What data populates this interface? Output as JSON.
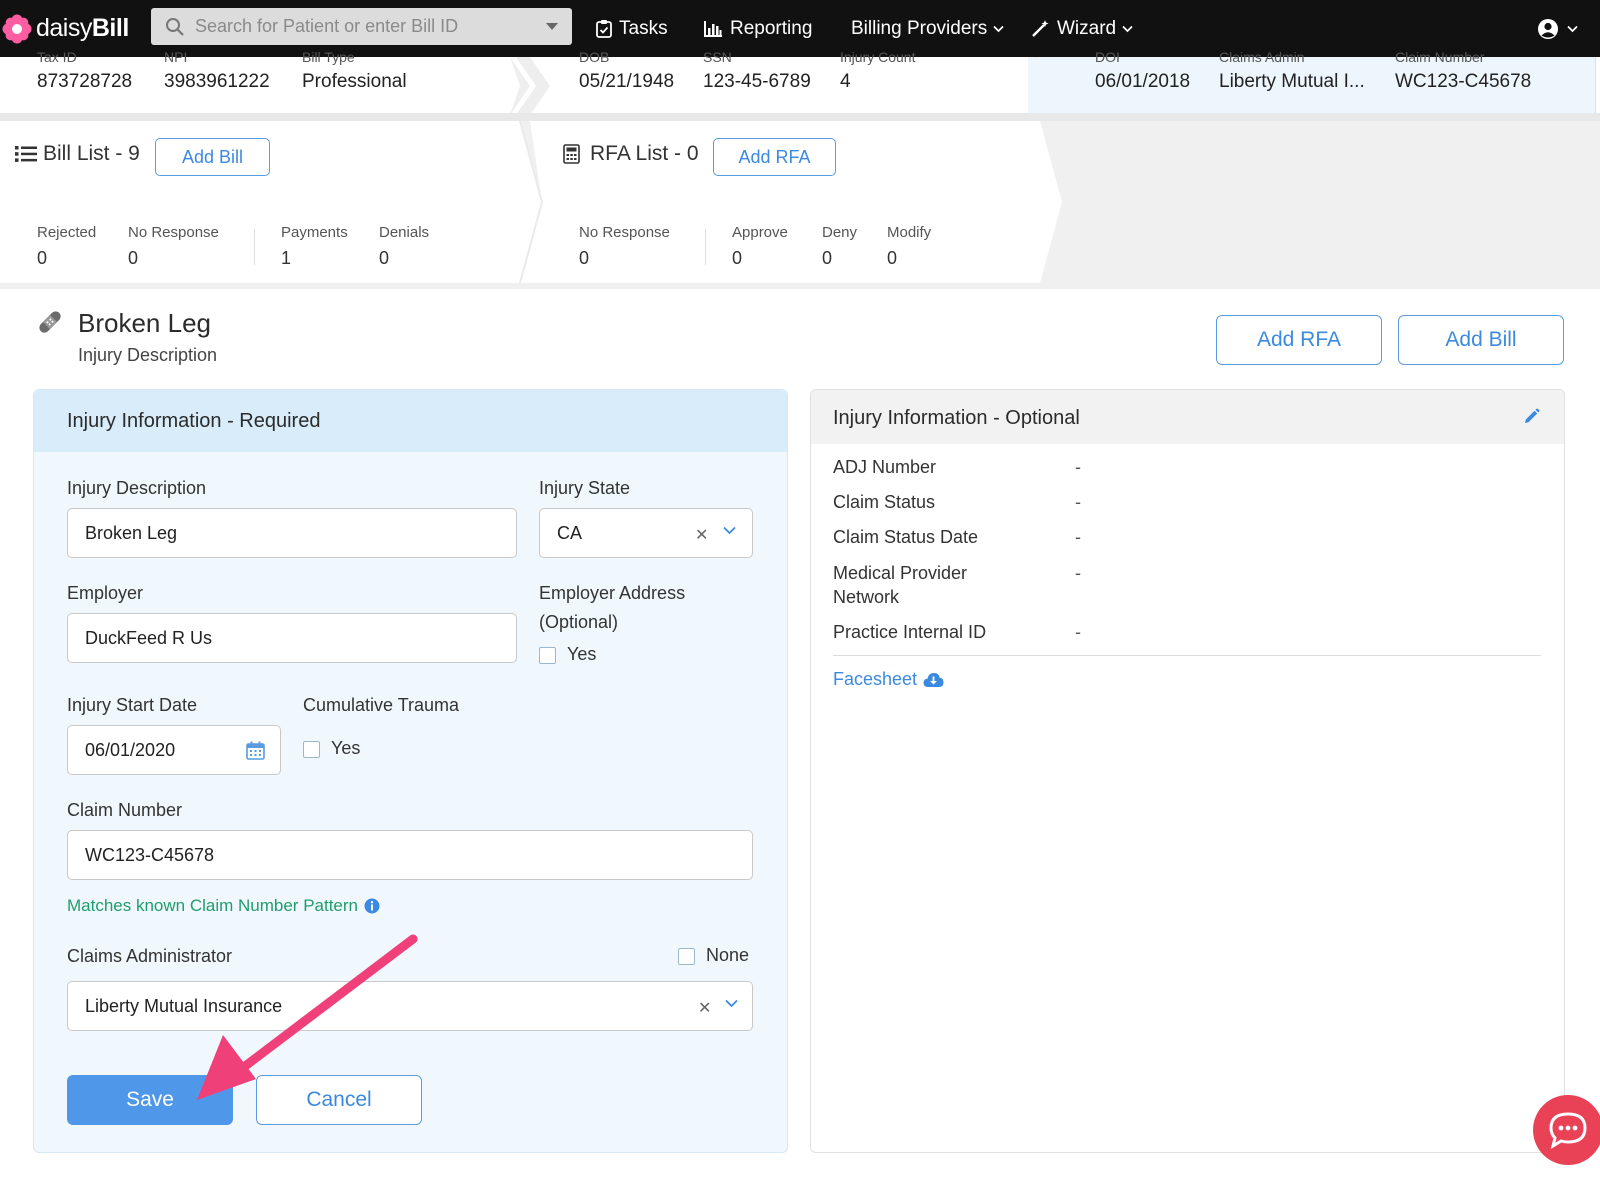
{
  "app": {
    "brand_light": "daisy",
    "brand_bold": "Bill"
  },
  "nav": {
    "search_placeholder": "Search for Patient or enter Bill ID",
    "tasks": "Tasks",
    "reporting": "Reporting",
    "billing_providers": "Billing Providers",
    "wizard": "Wizard"
  },
  "summary": {
    "provider": [
      {
        "label": "Tax ID",
        "value": "873728728"
      },
      {
        "label": "NPI",
        "value": "3983961222"
      },
      {
        "label": "Bill Type",
        "value": "Professional"
      }
    ],
    "patient": [
      {
        "label": "DOB",
        "value": "05/21/1948"
      },
      {
        "label": "SSN",
        "value": "123-45-6789"
      },
      {
        "label": "Injury Count",
        "value": "4"
      }
    ],
    "injury": [
      {
        "label": "DOI",
        "value": "06/01/2018"
      },
      {
        "label": "Claims Admin",
        "value": "Liberty Mutual I..."
      },
      {
        "label": "Claim Number",
        "value": "WC123-C45678"
      }
    ]
  },
  "bill_list": {
    "title": "Bill List - 9",
    "add_label": "Add Bill",
    "stats": [
      {
        "label": "Rejected",
        "value": "0"
      },
      {
        "label": "No Response",
        "value": "0"
      },
      {
        "label": "Payments",
        "value": "1"
      },
      {
        "label": "Denials",
        "value": "0"
      }
    ]
  },
  "rfa_list": {
    "title": "RFA List - 0",
    "add_label": "Add RFA",
    "stats": [
      {
        "label": "No Response",
        "value": "0"
      },
      {
        "label": "Approve",
        "value": "0"
      },
      {
        "label": "Deny",
        "value": "0"
      },
      {
        "label": "Modify",
        "value": "0"
      }
    ]
  },
  "injury": {
    "title": "Broken Leg",
    "subtitle": "Injury Description",
    "add_rfa": "Add RFA",
    "add_bill": "Add Bill"
  },
  "required": {
    "header": "Injury Information - Required",
    "injury_description_label": "Injury Description",
    "injury_description_value": "Broken Leg",
    "injury_state_label": "Injury State",
    "injury_state_value": "CA",
    "employer_label": "Employer",
    "employer_value": "DuckFeed R Us",
    "employer_address_label_1": "Employer Address",
    "employer_address_label_2": "(Optional)",
    "employer_address_yes": "Yes",
    "start_date_label": "Injury Start Date",
    "start_date_value": "06/01/2020",
    "cumulative_label": "Cumulative Trauma",
    "cumulative_yes": "Yes",
    "claim_number_label": "Claim Number",
    "claim_number_value": "WC123-C45678",
    "claim_hint": "Matches known Claim Number Pattern",
    "claims_admin_label": "Claims Administrator",
    "claims_admin_none": "None",
    "claims_admin_value": "Liberty Mutual Insurance",
    "save": "Save",
    "cancel": "Cancel"
  },
  "optional": {
    "header": "Injury Information - Optional",
    "rows": [
      {
        "label": "ADJ Number",
        "value": "-"
      },
      {
        "label": "Claim Status",
        "value": "-"
      },
      {
        "label": "Claim Status Date",
        "value": "-"
      },
      {
        "label_1": "Medical Provider",
        "label_2": "Network",
        "value": "-"
      },
      {
        "label": "Practice Internal ID",
        "value": "-"
      }
    ],
    "facesheet": "Facesheet"
  },
  "colors": {
    "accent": "#4f97e8",
    "arrow": "#f0407a",
    "chat": "#e94257",
    "hint": "#1f9d6b"
  }
}
